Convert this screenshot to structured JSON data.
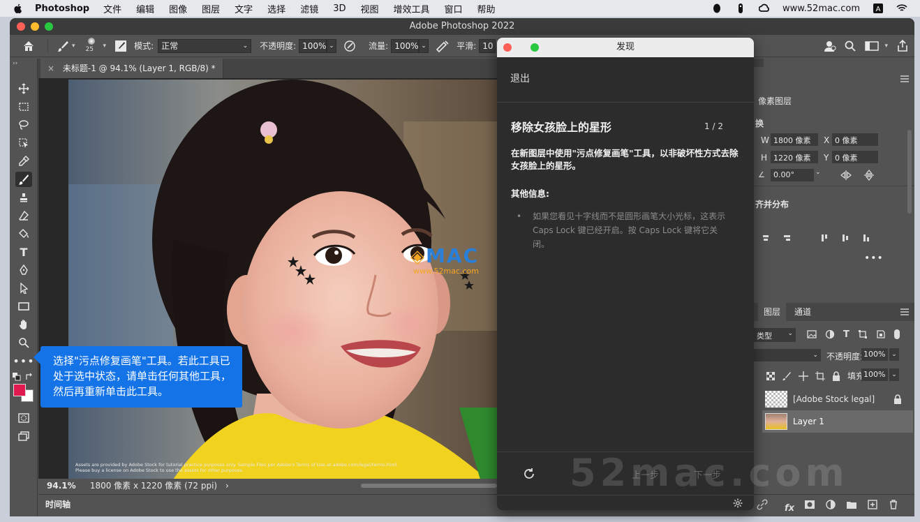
{
  "menubar": {
    "app_name": "Photoshop",
    "items": [
      "文件",
      "编辑",
      "图像",
      "图层",
      "文字",
      "选择",
      "滤镜",
      "3D",
      "视图",
      "增效工具",
      "窗口",
      "帮助"
    ],
    "site": "www.52mac.com"
  },
  "window": {
    "title": "Adobe Photoshop 2022"
  },
  "options_bar": {
    "brush_size": "25",
    "mode_label": "模式:",
    "mode_value": "正常",
    "opacity_label": "不透明度:",
    "opacity_value": "100%",
    "flow_label": "流量:",
    "flow_value": "100%",
    "smoothing_label": "平滑:",
    "smoothing_value": "10"
  },
  "document": {
    "tab_title": "未标题-1 @ 94.1% (Layer 1, RGB/8) *",
    "zoom": "94.1%",
    "size_info": "1800 像素 x 1220 像素 (72 ppi)",
    "caption_line1": "Assets are provided by Adobe Stock for tutorial practice purposes only. Sample Files per Adobe's Terms of Use at adobe.com/legal/terms.html.",
    "caption_line2": "Please buy a license on Adobe Stock to use the assets for other purposes."
  },
  "timeline": {
    "label": "时间轴"
  },
  "tooltip": {
    "text": "选择\"污点修复画笔\"工具。若此工具已处于选中状态，请单击任何其他工具，然后再重新单击此工具。"
  },
  "discover": {
    "title": "发现",
    "exit": "退出",
    "step_title": "移除女孩脸上的星形",
    "step_counter": "1 / 2",
    "instruction": "在新图层中使用\"污点修复画笔\"工具，以非破坏性方式去除女孩脸上的星形。",
    "more_info_heading": "其他信息:",
    "more_info_bullet": "如果您看见十字线而不是圆形画笔大小光标，这表示 Caps Lock 键已经开启。按 Caps Lock 键将它关闭。",
    "prev": "上一步",
    "next": "下一步"
  },
  "properties": {
    "tab": "像素图层",
    "section_transform": "换",
    "w_label": "W",
    "w_value": "1800 像素",
    "x_label": "X",
    "x_value": "0 像素",
    "h_label": "H",
    "h_value": "1220 像素",
    "y_label": "Y",
    "y_value": "0 像素",
    "angle_value": "0.00°",
    "section_align": "齐并分布"
  },
  "layers": {
    "tabs": [
      "图层",
      "通道"
    ],
    "kind_label": "类型",
    "opacity_label": "不透明度:",
    "opacity_value": "100%",
    "fill_label": "填充:",
    "fill_value": "100%",
    "items": [
      {
        "name": "[Adobe Stock legal]",
        "locked": true
      },
      {
        "name": "Layer 1",
        "locked": false
      }
    ]
  },
  "watermark": {
    "logo_text": "MAC",
    "logo_url": "www.52mac.com",
    "big_text": "52mac.com"
  },
  "colors": {
    "accent_blue": "#1473e6",
    "foreground_color": "#e0194f",
    "background_color": "#ffffff"
  }
}
